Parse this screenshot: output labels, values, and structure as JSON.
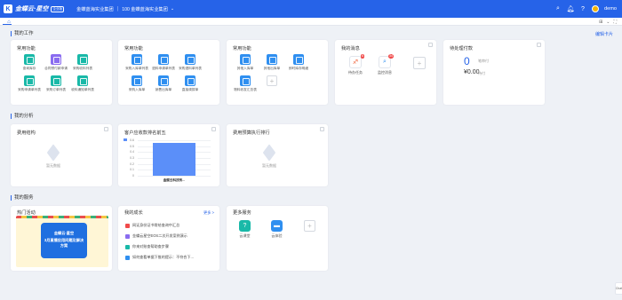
{
  "header": {
    "logo_mark": "K",
    "app_name": "金蝶云·星空",
    "app_tag": "企业版",
    "org_name": "金蝶蓝海实业集团",
    "data_center": "100 金蝶蓝海实业集团",
    "username": "demo"
  },
  "sections": {
    "work": "我的工作",
    "analysis": "我的分析",
    "service": "我的服务",
    "edit_card": "编辑卡片"
  },
  "common1": {
    "title": "常用功能",
    "items": [
      {
        "label": "查询库存",
        "color": "teal"
      },
      {
        "label": "合同预付款申请",
        "color": "purple"
      },
      {
        "label": "采购收料列表",
        "color": "teal"
      },
      {
        "label": "采购申请单列表",
        "color": "teal"
      },
      {
        "label": "采购订单列表",
        "color": "teal"
      },
      {
        "label": "收料通知单列表",
        "color": "teal"
      }
    ]
  },
  "common2": {
    "title": "常用功能",
    "items": [
      {
        "label": "采购入库单列表",
        "color": "blue"
      },
      {
        "label": "退料申请单列表",
        "color": "blue"
      },
      {
        "label": "采购退料单列表",
        "color": "blue"
      },
      {
        "label": "采购入库单",
        "color": "blue"
      },
      {
        "label": "销售出库单",
        "color": "blue"
      },
      {
        "label": "直接调拨单",
        "color": "blue"
      }
    ]
  },
  "common3": {
    "title": "常用功能",
    "items": [
      {
        "label": "其他入库单",
        "color": "blue"
      },
      {
        "label": "其他出库单",
        "color": "blue"
      },
      {
        "label": "即时库存明细",
        "color": "blue"
      },
      {
        "label": "物料收发汇总表",
        "color": "blue"
      }
    ]
  },
  "messages": {
    "title": "我的消息",
    "items": [
      {
        "label": "待办任务",
        "badge": "6"
      },
      {
        "label": "监控消息",
        "badge": "34"
      }
    ]
  },
  "payment": {
    "title": "待处理付款",
    "count": "0",
    "count_unit": "笔审付",
    "amount": "¥0.00",
    "amount_unit": "待付"
  },
  "analysis": {
    "expense": {
      "title": "费用结构",
      "empty": "暂无数据"
    },
    "ranking": {
      "title": "客户应收款排名前五"
    },
    "budget": {
      "title": "费用预算执行排行",
      "empty": "暂无数据"
    }
  },
  "chart_data": {
    "type": "bar",
    "title": "客户应收款排名前五",
    "categories": [
      "金蝶云科技有..."
    ],
    "values": [
      0.55
    ],
    "yticks": [
      "0.6",
      "0.5",
      "0.4",
      "0.3",
      "0.2",
      "0.1",
      "0"
    ],
    "ylim": [
      0,
      0.6
    ],
    "grid": true,
    "legend": "top-left",
    "color": "#5b8ff9"
  },
  "services": {
    "hot": {
      "title": "热门活动",
      "banner_line1": "金蝶云·星空",
      "banner_line2": "3月直播应用问题及解决方案"
    },
    "growth": {
      "title": "我的成长",
      "more": "更多 >",
      "items": [
        "网证身份证书常给查询中汇总",
        "金蝶云星空EOS二次开发案例演示",
        "你来对账查帮助查步骤",
        "如何查看单据下推的提示：不符合下..."
      ]
    },
    "more_services": {
      "title": "更多服务",
      "items": [
        "云课堂",
        "云体验"
      ]
    }
  },
  "side_tab": "Chat"
}
